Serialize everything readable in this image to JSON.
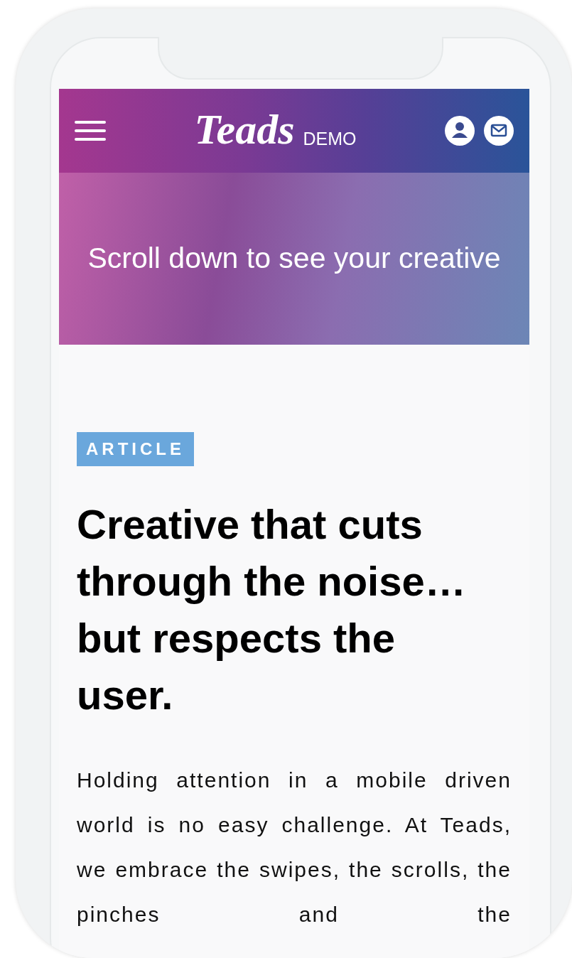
{
  "header": {
    "logo": "Teads",
    "logo_suffix": "DEMO"
  },
  "hero": {
    "text": "Scroll down to see your creative"
  },
  "article": {
    "category": "ARTICLE",
    "title": "Creative that cuts through the noise… but respects the user.",
    "body": "Holding attention in a mobile driven world is no easy challenge. At Teads, we embrace the swipes, the scrolls, the pinches and the"
  }
}
